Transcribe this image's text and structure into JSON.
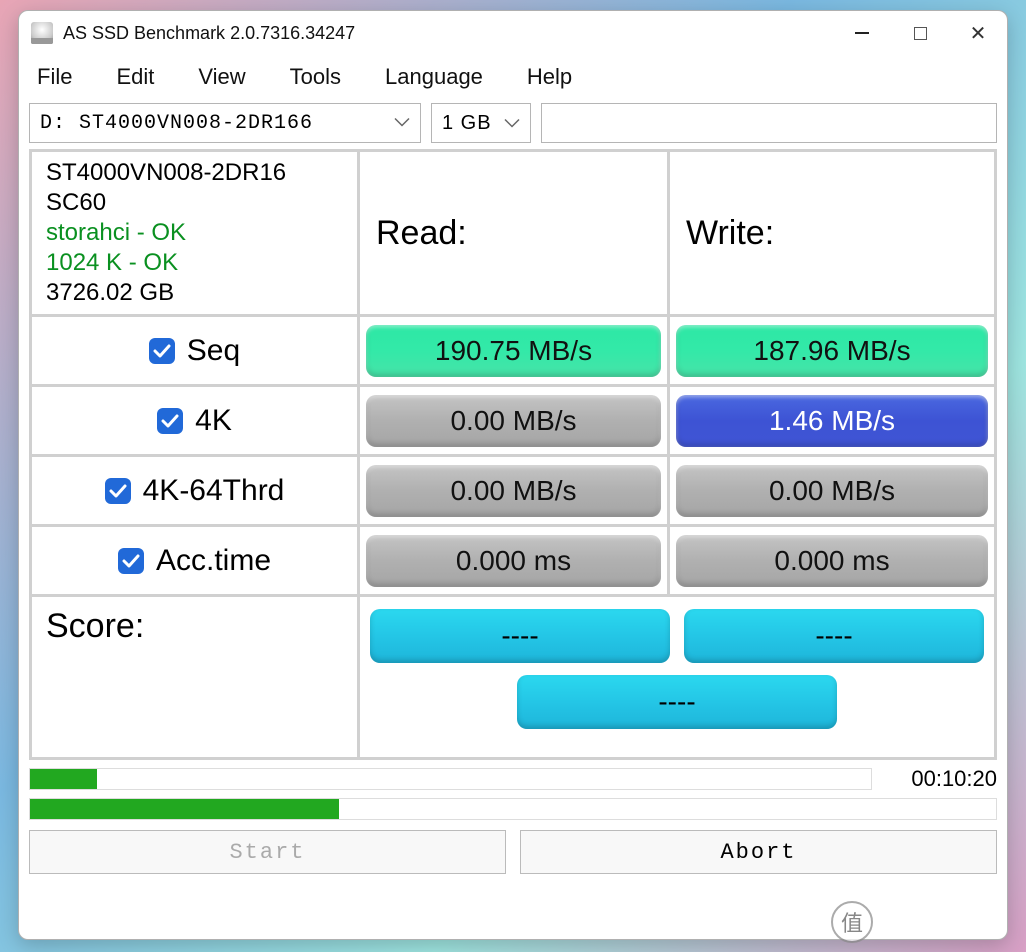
{
  "titlebar": {
    "title": "AS SSD Benchmark 2.0.7316.34247"
  },
  "menubar": {
    "file": "File",
    "edit": "Edit",
    "view": "View",
    "tools": "Tools",
    "language": "Language",
    "help": "Help"
  },
  "selectors": {
    "drive": "D: ST4000VN008-2DR166",
    "size": "1 GB"
  },
  "info": {
    "model": "ST4000VN008-2DR16",
    "firmware": "SC60",
    "driver": "storahci - OK",
    "alignment": "1024 K - OK",
    "capacity": "3726.02 GB"
  },
  "headers": {
    "read": "Read:",
    "write": "Write:"
  },
  "tests": {
    "seq": {
      "label": "Seq",
      "read": "190.75 MB/s",
      "write": "187.96 MB/s",
      "read_cls": "pill-green",
      "write_cls": "pill-green"
    },
    "k4": {
      "label": "4K",
      "read": "0.00 MB/s",
      "write": "1.46 MB/s",
      "read_cls": "pill-gray",
      "write_cls": "pill-blue"
    },
    "k4t": {
      "label": "4K-64Thrd",
      "read": "0.00 MB/s",
      "write": "0.00 MB/s",
      "read_cls": "pill-gray",
      "write_cls": "pill-gray"
    },
    "acc": {
      "label": "Acc.time",
      "read": "0.000 ms",
      "write": "0.000 ms",
      "read_cls": "pill-gray",
      "write_cls": "pill-gray"
    }
  },
  "score": {
    "label": "Score:",
    "read": "----",
    "write": "----",
    "total": "----"
  },
  "progress": {
    "p1_pct": 8,
    "p2_pct": 32,
    "elapsed": "00:10:20"
  },
  "buttons": {
    "start": "Start",
    "abort": "Abort"
  },
  "watermark": "什么值得买"
}
